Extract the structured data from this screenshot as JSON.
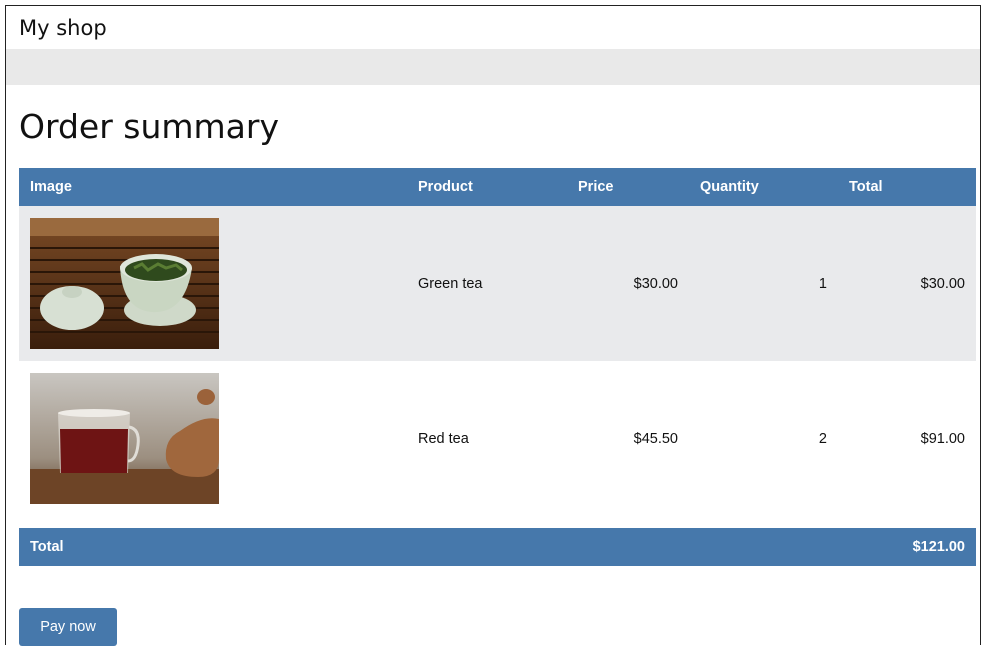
{
  "header": {
    "shop_name": "My shop"
  },
  "main": {
    "title": "Order summary",
    "table": {
      "columns": [
        "Image",
        "Product",
        "Price",
        "Quantity",
        "Total"
      ],
      "rows": [
        {
          "image": "green-tea-photo",
          "product": "Green tea",
          "price": "$30.00",
          "quantity": "1",
          "total": "$30.00"
        },
        {
          "image": "red-tea-photo",
          "product": "Red tea",
          "price": "$45.50",
          "quantity": "2",
          "total": "$91.00"
        }
      ],
      "footer": {
        "label": "Total",
        "amount": "$121.00"
      }
    },
    "pay_button_label": "Pay now"
  },
  "colors": {
    "accent": "#4678ab",
    "row_alt": "#e9eaec",
    "nav_bar": "#e9e9e9"
  }
}
